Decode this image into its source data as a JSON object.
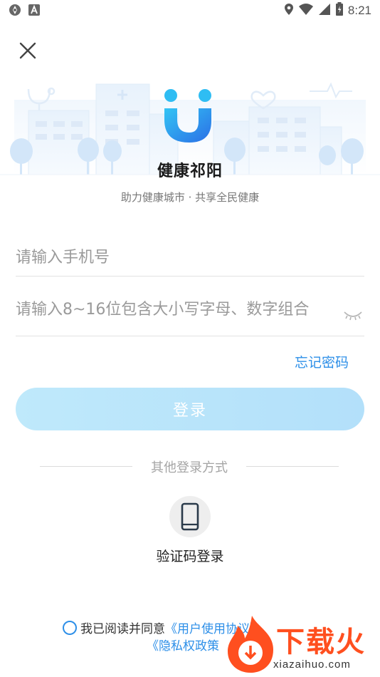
{
  "status_bar": {
    "time": "8:21",
    "icons": [
      "app-icon",
      "a-icon",
      "location-icon",
      "wifi-icon",
      "signal-icon",
      "battery-icon"
    ]
  },
  "app": {
    "name": "健康祁阳",
    "slogan": "助力健康城市 · 共享全民健康",
    "brand_color": "#2d8fe8"
  },
  "login_form": {
    "phone_placeholder": "请输入手机号",
    "password_placeholder": "请输入8~16位包含大小写字母、数字组合",
    "forgot_label": "忘记密码",
    "login_label": "登录"
  },
  "other_login": {
    "divider_label": "其他登录方式",
    "sms_label": "验证码登录"
  },
  "agreement": {
    "prefix": "我已阅读并同意",
    "user_agreement": "《用户使用协议》",
    "privacy_policy": "《隐私权政策"
  },
  "watermark": {
    "brand": "下载火",
    "url": "xiazaihuo.com"
  }
}
